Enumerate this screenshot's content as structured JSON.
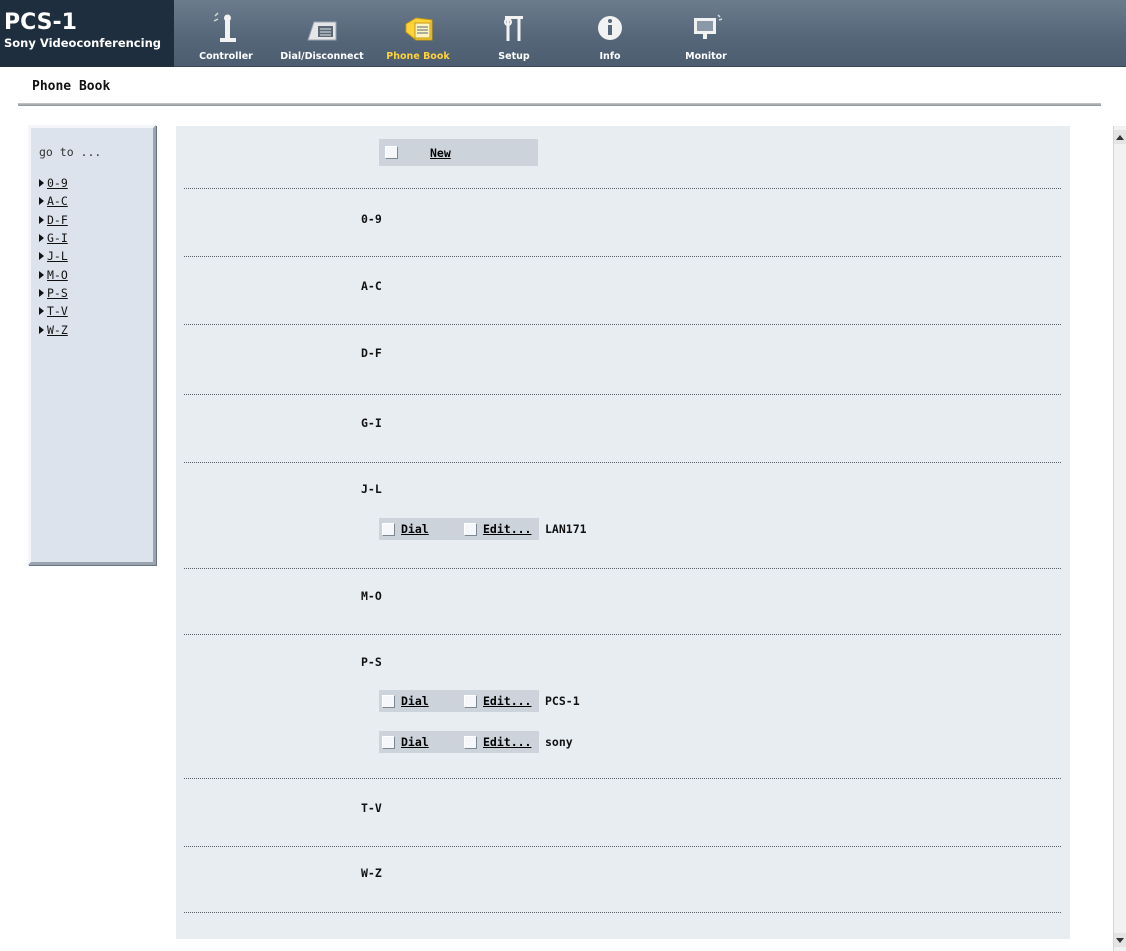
{
  "brand": {
    "title": "PCS-1",
    "subtitle": "Sony Videoconferencing"
  },
  "nav": [
    {
      "label": "Controller",
      "icon": "controller-icon",
      "active": false
    },
    {
      "label": "Dial/Disconnect",
      "icon": "dial-disconnect-icon",
      "active": false
    },
    {
      "label": "Phone Book",
      "icon": "phone-book-icon",
      "active": true
    },
    {
      "label": "Setup",
      "icon": "setup-icon",
      "active": false
    },
    {
      "label": "Info",
      "icon": "info-icon",
      "active": false
    },
    {
      "label": "Monitor",
      "icon": "monitor-icon",
      "active": false
    }
  ],
  "page": {
    "title": "Phone Book"
  },
  "goto": {
    "label": "go to ...",
    "items": [
      "0-9",
      "A-C",
      "D-F",
      "G-I",
      "J-L",
      "M-O",
      "P-S",
      "T-V",
      "W-Z"
    ]
  },
  "main": {
    "new_label": "New",
    "dial_label": "Dial",
    "edit_label": "Edit...",
    "sections": [
      {
        "label": "0-9",
        "entries": []
      },
      {
        "label": "A-C",
        "entries": []
      },
      {
        "label": "D-F",
        "entries": []
      },
      {
        "label": "G-I",
        "entries": []
      },
      {
        "label": "J-L",
        "entries": [
          "LAN171"
        ]
      },
      {
        "label": "M-O",
        "entries": []
      },
      {
        "label": "P-S",
        "entries": [
          "PCS-1",
          "sony"
        ]
      },
      {
        "label": "T-V",
        "entries": []
      },
      {
        "label": "W-Z",
        "entries": []
      }
    ]
  },
  "colors": {
    "accent_active": "#ffd23a",
    "topbar": "#56677a",
    "brand_bg": "#1f2e3e",
    "content_bg": "#e8edf2"
  }
}
